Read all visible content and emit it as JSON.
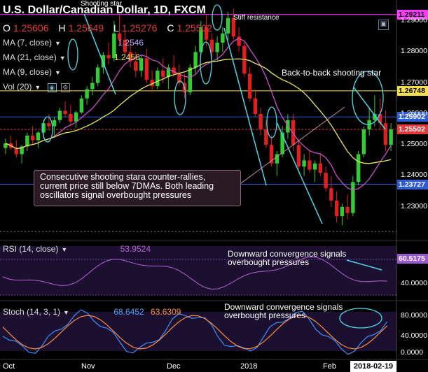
{
  "header": {
    "symbol_title": "U.S. Dollar/Canadian Dollar, 1D, FXCM",
    "ohlc": [
      {
        "key": "O",
        "value": "1.25606"
      },
      {
        "key": "H",
        "value": "1.25649"
      },
      {
        "key": "L",
        "value": "1.25276"
      },
      {
        "key": "C",
        "value": "1.25502"
      }
    ]
  },
  "indicators": [
    {
      "label": "MA (7, close)",
      "value": "1.2546",
      "color": "#e8e85a"
    },
    {
      "label": "MA (21, close)",
      "value": "1.2456",
      "color": "#e8e85a"
    },
    {
      "label": "MA (9, close)",
      "value": "",
      "color": "#cc4fcc"
    },
    {
      "label": "Vol (20)",
      "value": "",
      "color": "#cccccc"
    }
  ],
  "annotations": {
    "shooting_star": "Shooting star",
    "stiff_resistance": "Stiff resistance",
    "back_to_back": "Back-to-back shooting star",
    "note": "Consecutive shooting stara counter-rallies, current price still below 7DMAs. Both leading oscillators signal overbought pressures",
    "rsi_note": "Downward convergence signals overbought pressures",
    "stoch_note": "Downward convergence signals overbought pressures"
  },
  "price_tags": [
    {
      "value": "1.29211",
      "bg": "#ff3bff",
      "fg": "#000000",
      "price": 1.29211
    },
    {
      "value": "1.26748",
      "bg": "#f5e04a",
      "fg": "#000000",
      "price": 1.26748
    },
    {
      "value": "1.25902",
      "bg": "#2f5bd6",
      "fg": "#ffffff",
      "price": 1.25902
    },
    {
      "value": "1.25502",
      "bg": "#e23b3b",
      "fg": "#ffffff",
      "price": 1.25502
    },
    {
      "value": "1.23727",
      "bg": "#2f5bd6",
      "fg": "#ffffff",
      "price": 1.23727
    }
  ],
  "price_axis": [
    "1.29000",
    "1.28000",
    "1.27000",
    "1.26000",
    "1.25000",
    "1.24000",
    "1.23000"
  ],
  "rsi": {
    "label": "RSI (14, close)",
    "value": "53.9524",
    "tag": "60.5175",
    "tag_bg": "#9b59d0",
    "axis": [
      "40.0000"
    ]
  },
  "stoch": {
    "label": "Stoch (14, 3, 1)",
    "k_value": "68.6452",
    "d_value": "63.6309",
    "axis": [
      "80.0000",
      "40.0000",
      "0.0000"
    ]
  },
  "x_axis": [
    "Oct",
    "Nov",
    "Dec",
    "2018",
    "Feb"
  ],
  "cursor_date": "2018-02-19",
  "chart_data": {
    "type": "candlestick",
    "ylim": [
      1.22,
      1.295
    ],
    "candles": [
      [
        1.249,
        1.252,
        1.247,
        1.2505
      ],
      [
        1.2505,
        1.253,
        1.2485,
        1.249
      ],
      [
        1.249,
        1.2515,
        1.246,
        1.247
      ],
      [
        1.247,
        1.25,
        1.244,
        1.2495
      ],
      [
        1.2495,
        1.254,
        1.248,
        1.253
      ],
      [
        1.253,
        1.256,
        1.25,
        1.2515
      ],
      [
        1.2515,
        1.2545,
        1.249,
        1.254
      ],
      [
        1.254,
        1.258,
        1.252,
        1.257
      ],
      [
        1.257,
        1.26,
        1.2545,
        1.256
      ],
      [
        1.256,
        1.259,
        1.253,
        1.258
      ],
      [
        1.258,
        1.262,
        1.257,
        1.261
      ],
      [
        1.261,
        1.264,
        1.259,
        1.26
      ],
      [
        1.26,
        1.263,
        1.256,
        1.2575
      ],
      [
        1.2575,
        1.261,
        1.2555,
        1.2605
      ],
      [
        1.2605,
        1.266,
        1.26,
        1.265
      ],
      [
        1.265,
        1.269,
        1.263,
        1.268
      ],
      [
        1.268,
        1.272,
        1.266,
        1.27
      ],
      [
        1.27,
        1.276,
        1.269,
        1.275
      ],
      [
        1.275,
        1.28,
        1.273,
        1.279
      ],
      [
        1.279,
        1.283,
        1.276,
        1.278
      ],
      [
        1.278,
        1.29,
        1.277,
        1.286
      ],
      [
        1.286,
        1.292,
        1.282,
        1.284
      ],
      [
        1.284,
        1.287,
        1.279,
        1.28
      ],
      [
        1.28,
        1.283,
        1.275,
        1.277
      ],
      [
        1.277,
        1.28,
        1.272,
        1.274
      ],
      [
        1.274,
        1.279,
        1.272,
        1.278
      ],
      [
        1.278,
        1.281,
        1.27,
        1.271
      ],
      [
        1.271,
        1.274,
        1.267,
        1.269
      ],
      [
        1.269,
        1.275,
        1.268,
        1.274
      ],
      [
        1.274,
        1.278,
        1.27,
        1.272
      ],
      [
        1.272,
        1.276,
        1.268,
        1.275
      ],
      [
        1.275,
        1.279,
        1.272,
        1.273
      ],
      [
        1.273,
        1.276,
        1.269,
        1.27
      ],
      [
        1.27,
        1.273,
        1.265,
        1.267
      ],
      [
        1.267,
        1.276,
        1.266,
        1.275
      ],
      [
        1.275,
        1.282,
        1.273,
        1.28
      ],
      [
        1.28,
        1.29,
        1.279,
        1.288
      ],
      [
        1.288,
        1.292,
        1.282,
        1.284
      ],
      [
        1.284,
        1.286,
        1.278,
        1.28
      ],
      [
        1.28,
        1.285,
        1.277,
        1.283
      ],
      [
        1.283,
        1.288,
        1.28,
        1.286
      ],
      [
        1.286,
        1.293,
        1.284,
        1.291
      ],
      [
        1.291,
        1.294,
        1.284,
        1.285
      ],
      [
        1.285,
        1.288,
        1.28,
        1.282
      ],
      [
        1.282,
        1.283,
        1.272,
        1.273
      ],
      [
        1.273,
        1.275,
        1.264,
        1.265
      ],
      [
        1.265,
        1.268,
        1.259,
        1.26
      ],
      [
        1.26,
        1.262,
        1.253,
        1.255
      ],
      [
        1.255,
        1.258,
        1.249,
        1.25
      ],
      [
        1.25,
        1.253,
        1.243,
        1.244
      ],
      [
        1.244,
        1.248,
        1.24,
        1.247
      ],
      [
        1.247,
        1.256,
        1.246,
        1.254
      ],
      [
        1.254,
        1.26,
        1.252,
        1.258
      ],
      [
        1.258,
        1.26,
        1.248,
        1.25
      ],
      [
        1.25,
        1.252,
        1.242,
        1.243
      ],
      [
        1.243,
        1.247,
        1.24,
        1.245
      ],
      [
        1.245,
        1.248,
        1.241,
        1.242
      ],
      [
        1.242,
        1.245,
        1.238,
        1.244
      ],
      [
        1.244,
        1.247,
        1.24,
        1.241
      ],
      [
        1.241,
        1.243,
        1.235,
        1.236
      ],
      [
        1.236,
        1.24,
        1.23,
        1.232
      ],
      [
        1.232,
        1.235,
        1.225,
        1.227
      ],
      [
        1.227,
        1.231,
        1.224,
        1.23
      ],
      [
        1.23,
        1.234,
        1.226,
        1.228
      ],
      [
        1.228,
        1.24,
        1.227,
        1.238
      ],
      [
        1.238,
        1.248,
        1.237,
        1.247
      ],
      [
        1.247,
        1.256,
        1.246,
        1.255
      ],
      [
        1.255,
        1.262,
        1.253,
        1.258
      ],
      [
        1.258,
        1.266,
        1.256,
        1.26
      ],
      [
        1.26,
        1.265,
        1.255,
        1.257
      ],
      [
        1.257,
        1.261,
        1.248,
        1.25
      ],
      [
        1.25,
        1.257,
        1.248,
        1.255
      ]
    ],
    "horizontal_levels": [
      1.29211,
      1.26748,
      1.25902,
      1.25502,
      1.23727,
      1.222
    ]
  }
}
